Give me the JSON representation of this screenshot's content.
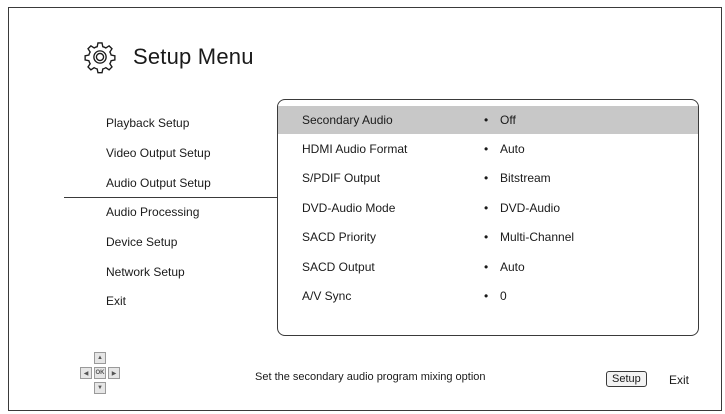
{
  "header": {
    "title": "Setup Menu",
    "icon": "gear-icon"
  },
  "sidebar": {
    "items": [
      {
        "label": "Playback Setup"
      },
      {
        "label": "Video Output Setup"
      },
      {
        "label": "Audio Output Setup",
        "active": true
      },
      {
        "label": "Audio Processing"
      },
      {
        "label": "Device Setup"
      },
      {
        "label": "Network Setup"
      },
      {
        "label": "Exit"
      }
    ]
  },
  "panel": {
    "rows": [
      {
        "label": "Secondary Audio",
        "bullet": "•",
        "value": "Off",
        "selected": true
      },
      {
        "label": "HDMI Audio Format",
        "bullet": "•",
        "value": "Auto"
      },
      {
        "label": "S/PDIF Output",
        "bullet": "•",
        "value": "Bitstream"
      },
      {
        "label": "DVD-Audio Mode",
        "bullet": "•",
        "value": "DVD-Audio"
      },
      {
        "label": "SACD Priority",
        "bullet": "•",
        "value": "Multi-Channel"
      },
      {
        "label": "SACD Output",
        "bullet": "•",
        "value": "Auto"
      },
      {
        "label": "A/V Sync",
        "bullet": "•",
        "value": "0"
      }
    ]
  },
  "footer": {
    "hint": "Set the secondary audio program mixing option",
    "setup_key": "Setup",
    "exit_label": "Exit",
    "dpad": {
      "up": "▲",
      "down": "▼",
      "left": "◀",
      "right": "▶",
      "ok": "OK"
    }
  },
  "colors": {
    "selected_row": "#c8c8c8",
    "border": "#3a3a3a",
    "text": "#1a1a1a"
  }
}
